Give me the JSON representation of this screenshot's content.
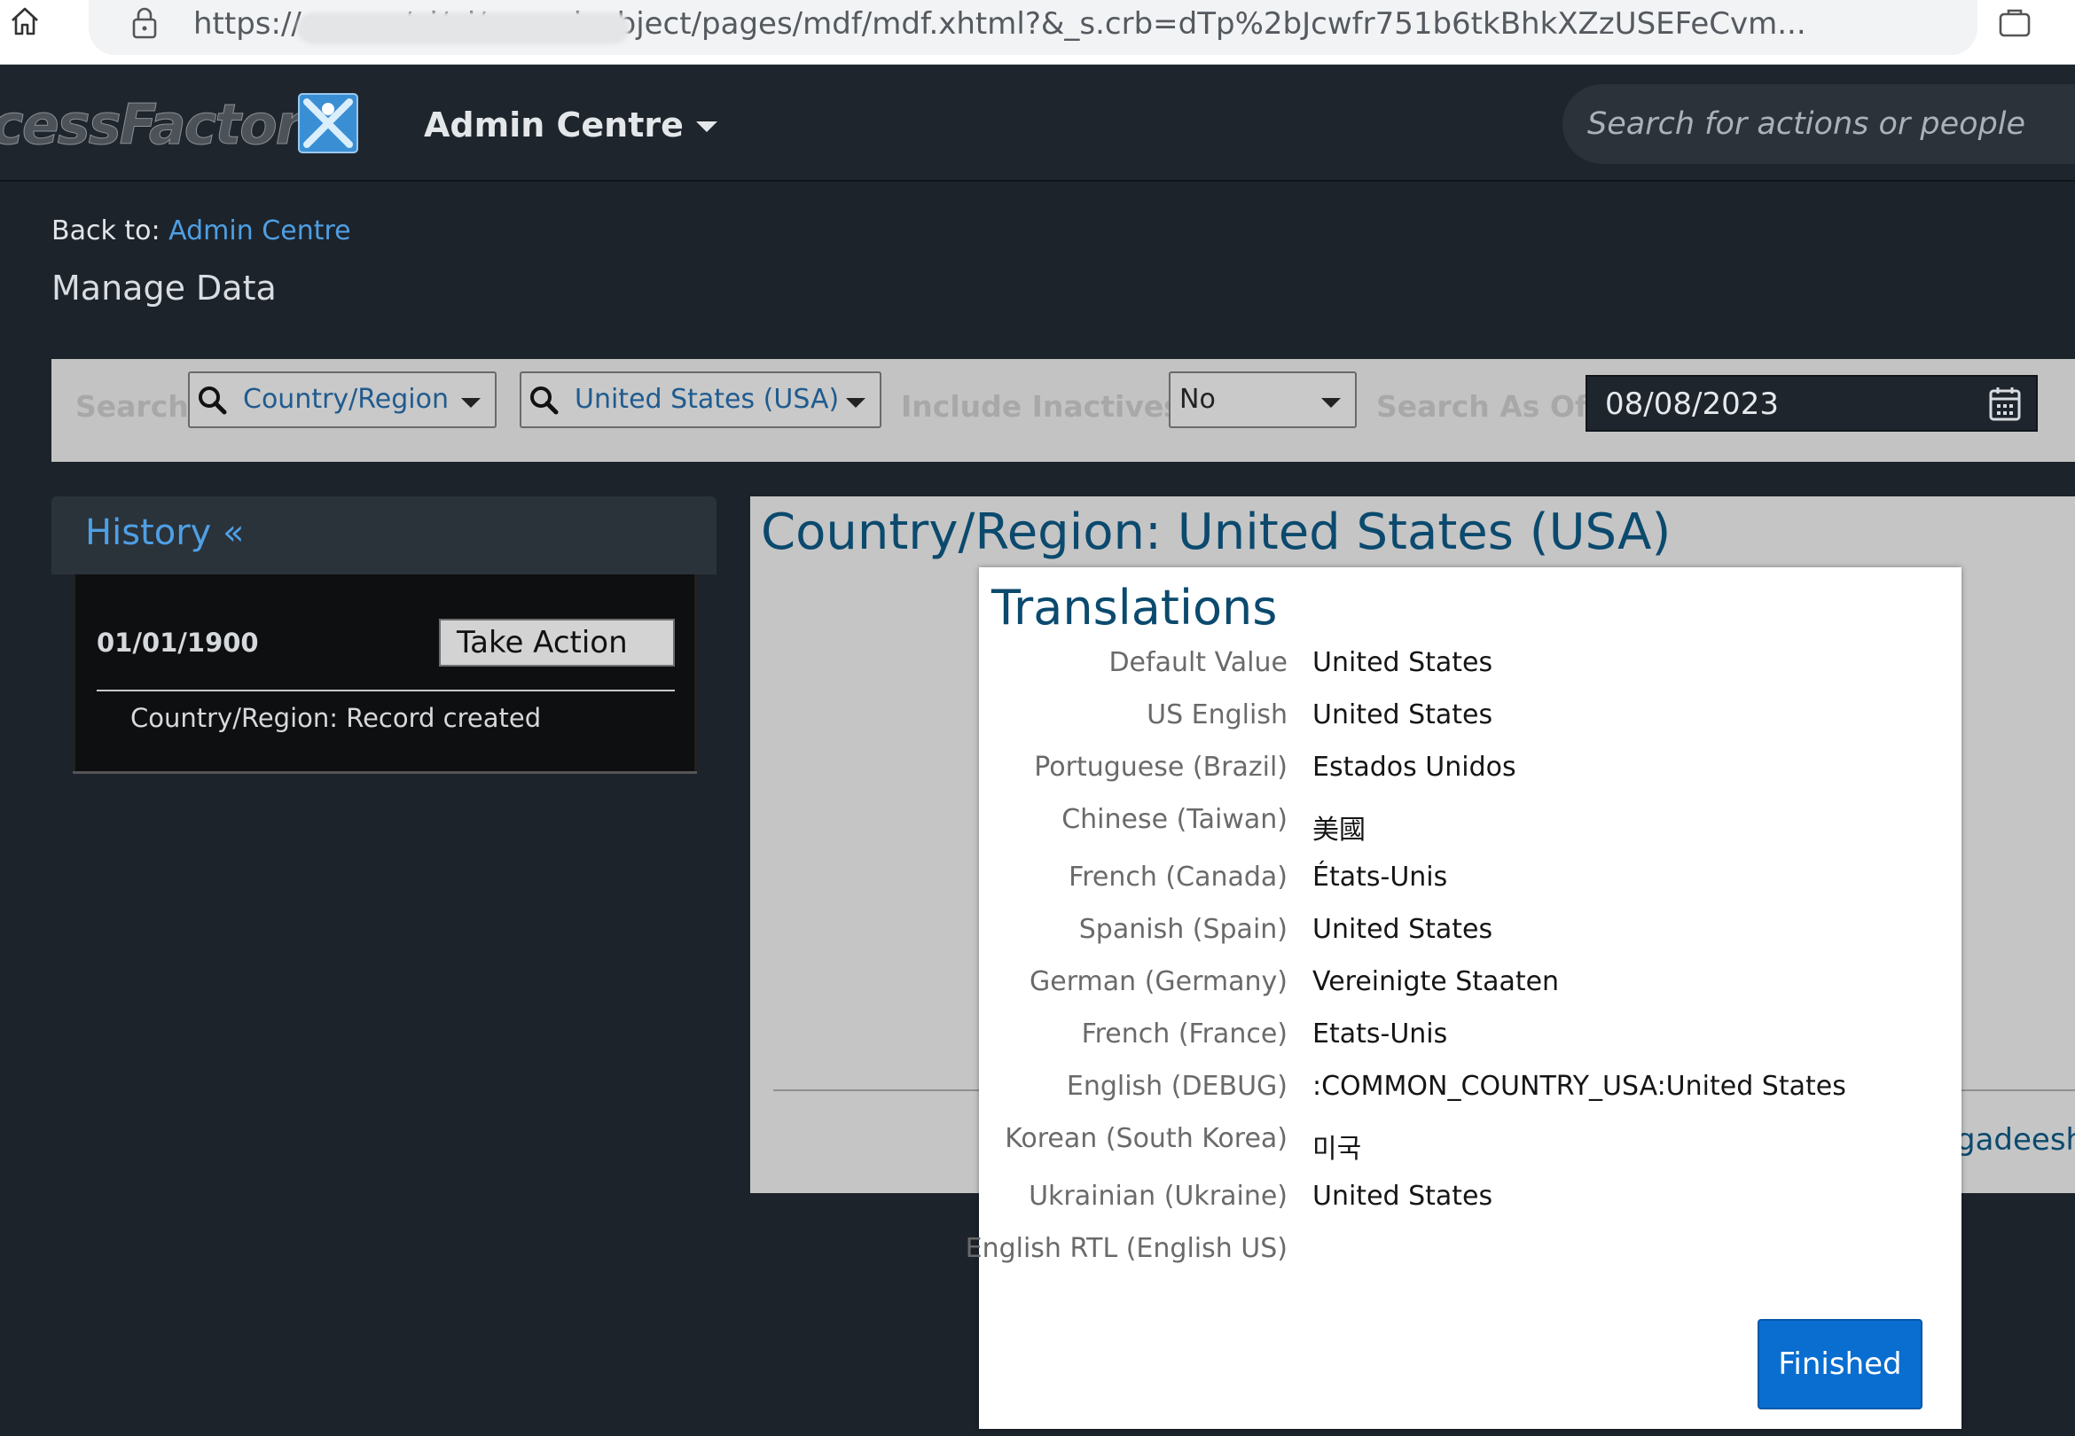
{
  "browser": {
    "url": "https://c                                      .com/xi/ui/genericobject/pages/mdf/mdf.xhtml?&_s.crb=dTp%2bJcwfr751b6tkBhkXZzUSEFeCvm..."
  },
  "header": {
    "logo_text": "cessFactors",
    "menu_label": "Admin Centre",
    "search_placeholder": "Search for actions or people"
  },
  "page": {
    "back_prefix": "Back to: ",
    "back_link": "Admin Centre",
    "title": "Manage Data"
  },
  "search_bar": {
    "search_label": "Search",
    "object_type": "Country/Region",
    "object_value": "United States (USA)",
    "include_inactives_label": "Include Inactives:",
    "include_inactives_value": "No",
    "search_as_of_label": "Search As Of:",
    "search_as_of_value": "08/08/2023"
  },
  "history": {
    "title": "History «",
    "date": "01/01/1900",
    "take_action_label": "Take Action",
    "entry": "Country/Region: Record created"
  },
  "main": {
    "title": "Country/Region: United States (USA)",
    "owner_fragment": "gadeesha"
  },
  "translations": {
    "title": "Translations",
    "rows": [
      {
        "label": "Default Value",
        "value": "United States"
      },
      {
        "label": "US English",
        "value": "United States"
      },
      {
        "label": "Portuguese (Brazil)",
        "value": "Estados Unidos"
      },
      {
        "label": "Chinese (Taiwan)",
        "value": "美國"
      },
      {
        "label": "French (Canada)",
        "value": "États-Unis"
      },
      {
        "label": "Spanish (Spain)",
        "value": "United States"
      },
      {
        "label": "German (Germany)",
        "value": "Vereinigte Staaten"
      },
      {
        "label": "French (France)",
        "value": "Etats-Unis"
      },
      {
        "label": "English (DEBUG)",
        "value": ":COMMON_COUNTRY_USA:United States"
      },
      {
        "label": "Korean (South Korea)",
        "value": "미국"
      },
      {
        "label": "Ukrainian (Ukraine)",
        "value": "United States"
      },
      {
        "label": "English RTL (English US)",
        "value": ""
      }
    ],
    "finished_label": "Finished"
  },
  "colors": {
    "accent": "#0a6ed1",
    "link": "#4f9fe4",
    "title_blue": "#0b4a6e",
    "header_bg": "#1f252c"
  }
}
